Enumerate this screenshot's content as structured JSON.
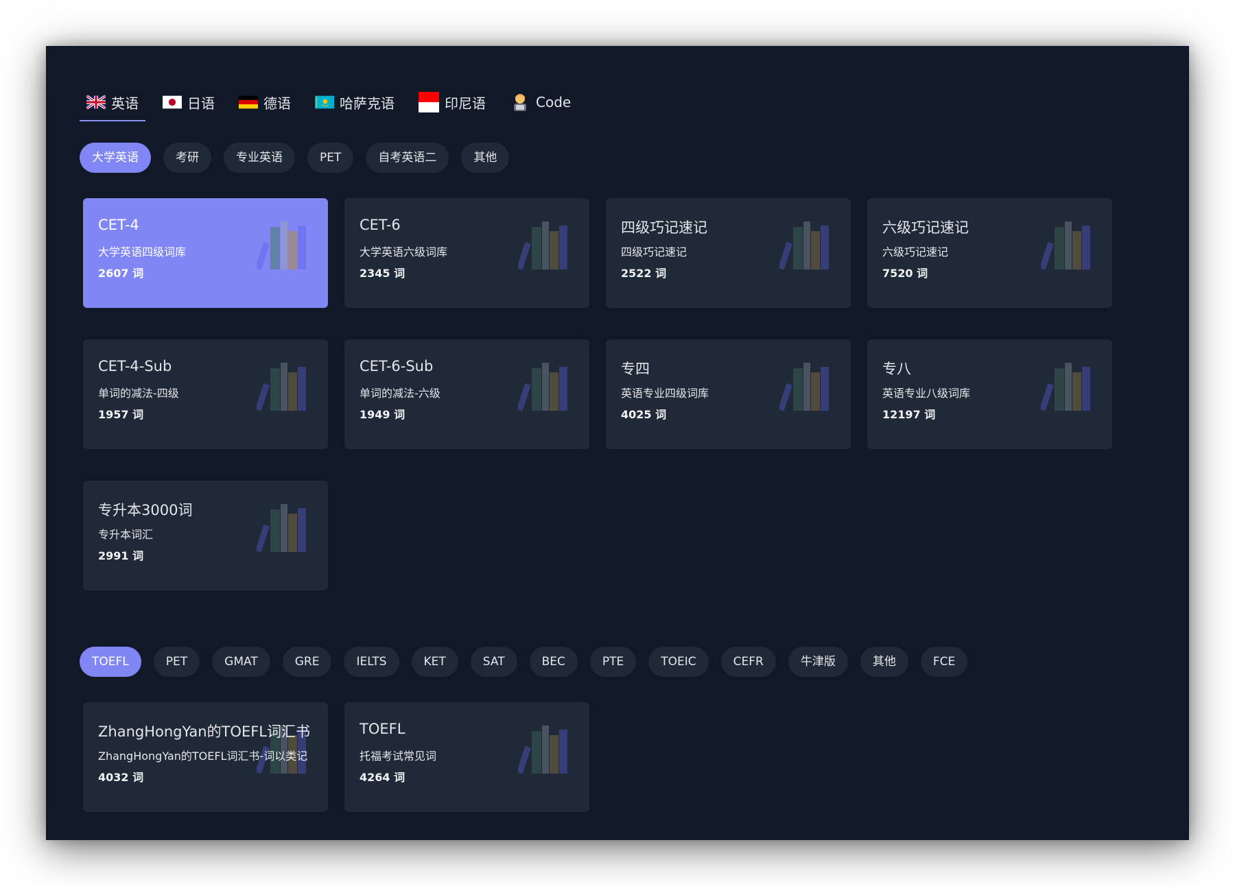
{
  "language_tabs": [
    {
      "label": "英语",
      "flag": "uk-flag-icon"
    },
    {
      "label": "日语",
      "flag": "japan-flag-icon"
    },
    {
      "label": "德语",
      "flag": "germany-flag-icon"
    },
    {
      "label": "哈萨克语",
      "flag": "kazakhstan-flag-icon"
    },
    {
      "label": "印尼语",
      "flag": "indonesia-flag-icon"
    },
    {
      "label": "Code",
      "flag": "developer-emoji-icon"
    }
  ],
  "active_language": "英语",
  "section1": {
    "filters": [
      "大学英语",
      "考研",
      "专业英语",
      "PET",
      "自考英语二",
      "其他"
    ],
    "active_filter": "大学英语",
    "cards": [
      {
        "title": "CET-4",
        "subtitle": "大学英语四级词库",
        "count": "2607 词",
        "active": true
      },
      {
        "title": "CET-6",
        "subtitle": "大学英语六级词库",
        "count": "2345 词"
      },
      {
        "title": "四级巧记速记",
        "subtitle": "四级巧记速记",
        "count": "2522 词"
      },
      {
        "title": "六级巧记速记",
        "subtitle": "六级巧记速记",
        "count": "7520 词"
      },
      {
        "title": "CET-4-Sub",
        "subtitle": "单词的减法-四级",
        "count": "1957 词"
      },
      {
        "title": "CET-6-Sub",
        "subtitle": "单词的减法-六级",
        "count": "1949 词"
      },
      {
        "title": "专四",
        "subtitle": "英语专业四级词库",
        "count": "4025 词"
      },
      {
        "title": "专八",
        "subtitle": "英语专业八级词库",
        "count": "12197 词"
      },
      {
        "title": "专升本3000词",
        "subtitle": "专升本词汇",
        "count": "2991 词"
      }
    ]
  },
  "section2": {
    "filters": [
      "TOEFL",
      "PET",
      "GMAT",
      "GRE",
      "IELTS",
      "KET",
      "SAT",
      "BEC",
      "PTE",
      "TOEIC",
      "CEFR",
      "牛津版",
      "其他",
      "FCE"
    ],
    "active_filter": "TOEFL",
    "cards": [
      {
        "title": "ZhangHongYan的TOEFL词汇书",
        "subtitle": "ZhangHongYan的TOEFL词汇书-词以类记",
        "count": "4032 词"
      },
      {
        "title": "TOEFL",
        "subtitle": "托福考试常见词",
        "count": "4264 词"
      }
    ]
  },
  "colors": {
    "background": "#111827",
    "card": "#1f2937",
    "accent": "#8087f5"
  },
  "card_icon": "books-icon"
}
